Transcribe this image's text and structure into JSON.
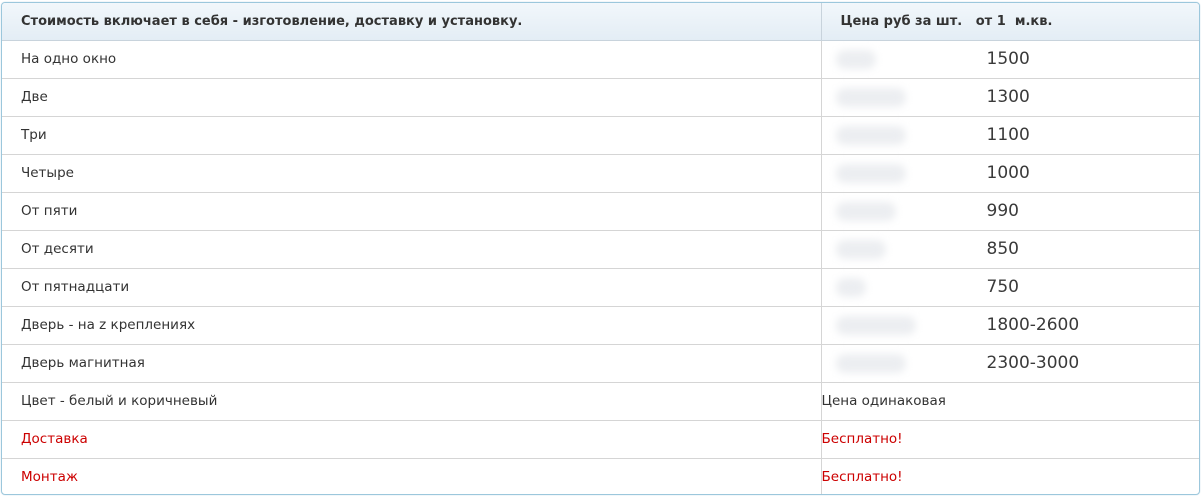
{
  "header": {
    "description": "Стоимость включает в себя - изготовление, доставку и установку.",
    "price_column": "Цена руб за шт.   от 1  м.кв."
  },
  "rows": [
    {
      "label": "На одно окно",
      "price": "1500"
    },
    {
      "label": "Две",
      "price": "1300"
    },
    {
      "label": "Три",
      "price": "1100"
    },
    {
      "label": "Четыре",
      "price": "1000"
    },
    {
      "label": "От пяти",
      "price": "990"
    },
    {
      "label": "От десяти",
      "price": "850"
    },
    {
      "label": "От пятнадцати",
      "price": "750"
    },
    {
      "label": "Дверь - на z креплениях",
      "price": "1800-2600"
    },
    {
      "label": "Дверь магнитная",
      "price": "2300-3000"
    }
  ],
  "extra_rows": [
    {
      "label": "Цвет - белый и коричневый",
      "value": "Цена одинаковая"
    },
    {
      "label": "Доставка",
      "value": "Бесплатно!"
    },
    {
      "label": "Монтаж",
      "value": "Бесплатно!"
    }
  ],
  "colors": {
    "accent_red": "#cc0000",
    "border_blue": "#9cc7dc",
    "header_bg": "#e3edf5"
  }
}
